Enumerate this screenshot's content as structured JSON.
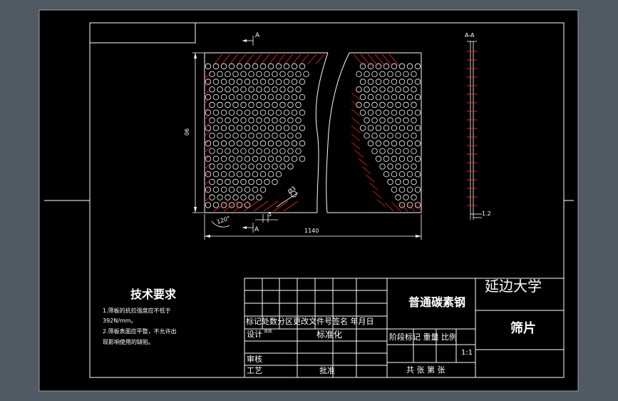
{
  "drawing": {
    "section_marker_label": "A",
    "section_view_title": "A-A",
    "dim_height": "90",
    "dim_width": "1140",
    "dim_gap": "5",
    "dim_angle": "120°",
    "dim_hole": "Ø3",
    "dim_thickness": "1.2"
  },
  "notes": {
    "heading": "技术要求",
    "line1": "1.筛板的抗拉强度应不低于",
    "line2": "392N/mm。",
    "line3": "2.筛板表面应平整，不允许出",
    "line4": "现影响使用的缺陷。"
  },
  "title_block": {
    "material": "普通碳素钢",
    "school": "延边大学",
    "part_name": "筛片",
    "row_header": "标记处数分区更改文件号签名 年月日",
    "design": "设计",
    "design_sub": "张凯",
    "standardize": "标准化",
    "stage_header": "阶段标记 重量 比例",
    "scale": "1:1",
    "review": "审核",
    "process": "工艺",
    "approve": "批准",
    "sheets": "共  张 第  张"
  },
  "colors": {
    "background": "#515963",
    "sheet": "#000000",
    "lines": "#ffffff",
    "hatch": "#ff2020"
  }
}
